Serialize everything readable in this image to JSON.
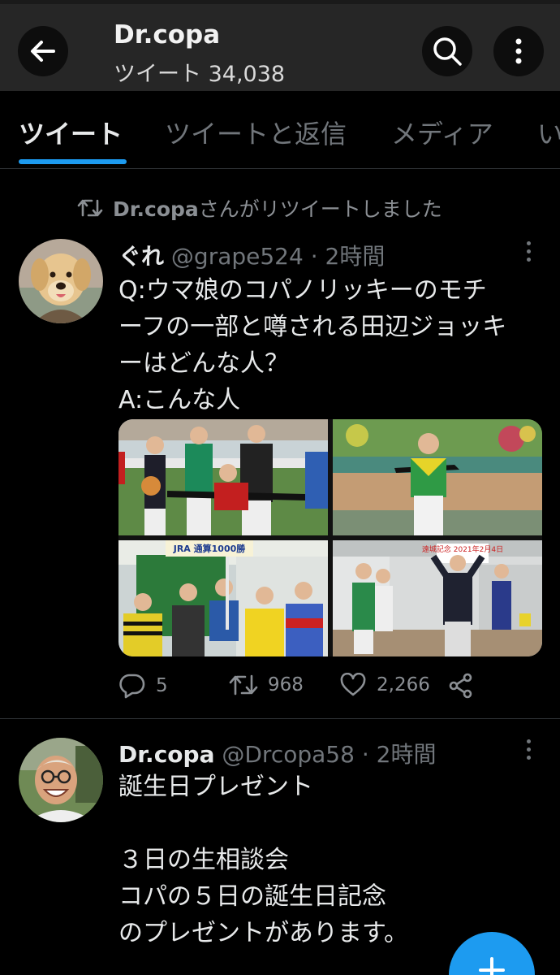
{
  "header": {
    "title": "Dr.copa",
    "tweet_count": "ツイート 34,038"
  },
  "tabs": [
    {
      "label": "ツイート"
    },
    {
      "label": "ツイートと返信"
    },
    {
      "label": "メディア"
    },
    {
      "label": "い"
    }
  ],
  "retweet_notice": {
    "name": "Dr.copa",
    "text": "さんがリツイートしました"
  },
  "tweets": [
    {
      "name": "ぐれ",
      "handle": "@grape524",
      "time": "· 2時間",
      "text": "Q:ウマ娘のコパノリッキーのモチ\nーフの一部と噂される田辺ジョッキ\nーはどんな人？\nA:こんな人",
      "photos": {
        "sign_1": "JRA\n通算1000勝",
        "sign_2": "遠城記念\n2021年2月4日"
      },
      "replies": "5",
      "retweets": "968",
      "likes": "2,266"
    },
    {
      "name": "Dr.copa",
      "handle": "@Drcopa58",
      "time": "· 2時間",
      "text": "誕生日プレゼント\n\n３日の生相談会\nコパの５日の誕生日記念\nのプレゼントがあります。"
    }
  ],
  "colors": {
    "accent": "#1d9bf0",
    "header_bg": "#262626",
    "muted_text": "#71767b"
  },
  "icons": [
    "back-arrow-icon",
    "search-icon",
    "more-vertical-icon",
    "retweet-icon",
    "reply-icon",
    "heart-icon",
    "share-icon",
    "compose-plus-icon"
  ]
}
